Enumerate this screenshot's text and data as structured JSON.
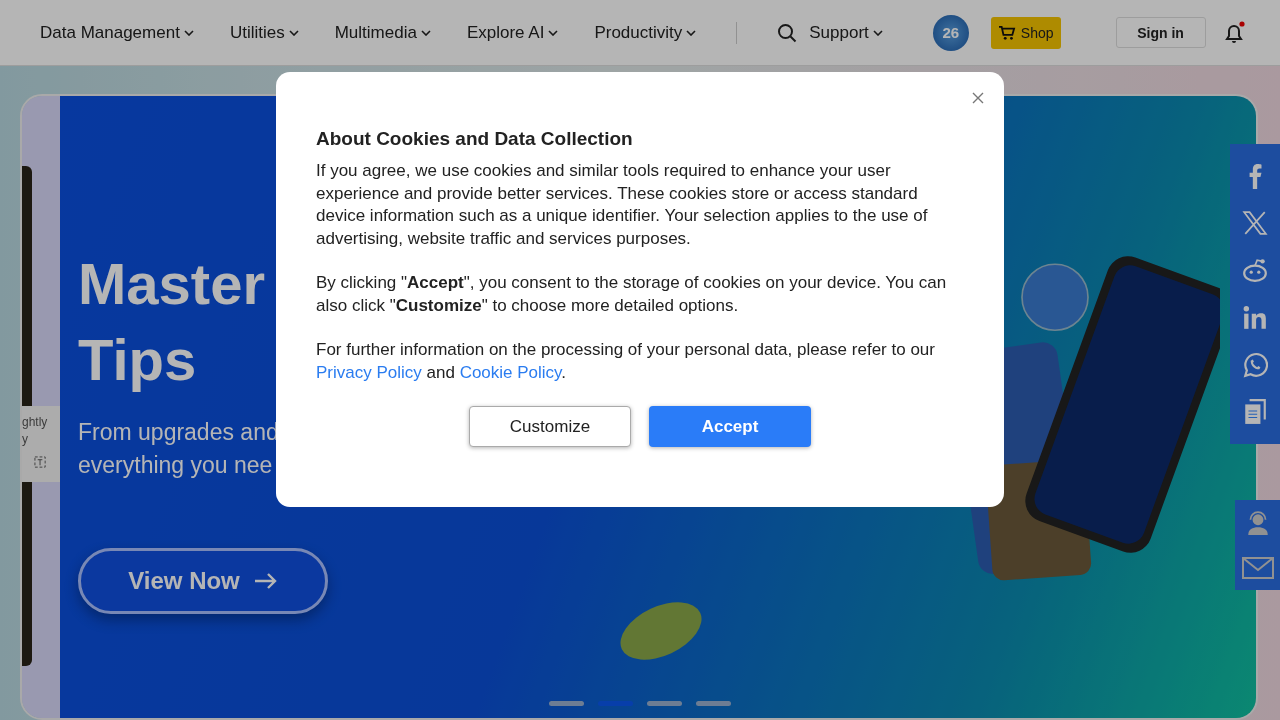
{
  "nav": {
    "menus": [
      {
        "label": "Data Management"
      },
      {
        "label": "Utilities"
      },
      {
        "label": "Multimedia"
      },
      {
        "label": "Explore AI"
      },
      {
        "label": "Productivity"
      }
    ],
    "support": "Support",
    "badge": "26",
    "shop": "Shop",
    "sign_in": "Sign in",
    "notification_unread": true
  },
  "hero": {
    "title_lines": [
      "Master",
      "Tips"
    ],
    "subtitle_lines": [
      "From upgrades and",
      "everything you nee"
    ],
    "button": "View Now",
    "side_card_lines": [
      "ghtly",
      "y"
    ],
    "slides": [
      {
        "selected": false
      },
      {
        "selected": true
      },
      {
        "selected": false
      },
      {
        "selected": false
      }
    ]
  },
  "cookie_dialog": {
    "title": "About Cookies and Data Collection",
    "paragraphs": [
      "If you agree, we use cookies and similar tools required to enhance your user experience and provide better services. These cookies store or access standard device information such as a unique identifier. Your selection applies to the use of advertising, website traffic and services purposes.",
      "By clicking \"**Accept**\", you consent to the storage of cookies on your device. You can also click \"**Customize**\" to choose more detailed options."
    ],
    "policy_text": "For further information on the processing of your personal data, please refer to our",
    "privacy_link": "Privacy Policy",
    "and": "and",
    "cookie_link": "Cookie Policy",
    "end": ".",
    "buttons": [
      {
        "label": "Customize",
        "kind": "secondary"
      },
      {
        "label": "Accept",
        "kind": "primary"
      }
    ]
  }
}
